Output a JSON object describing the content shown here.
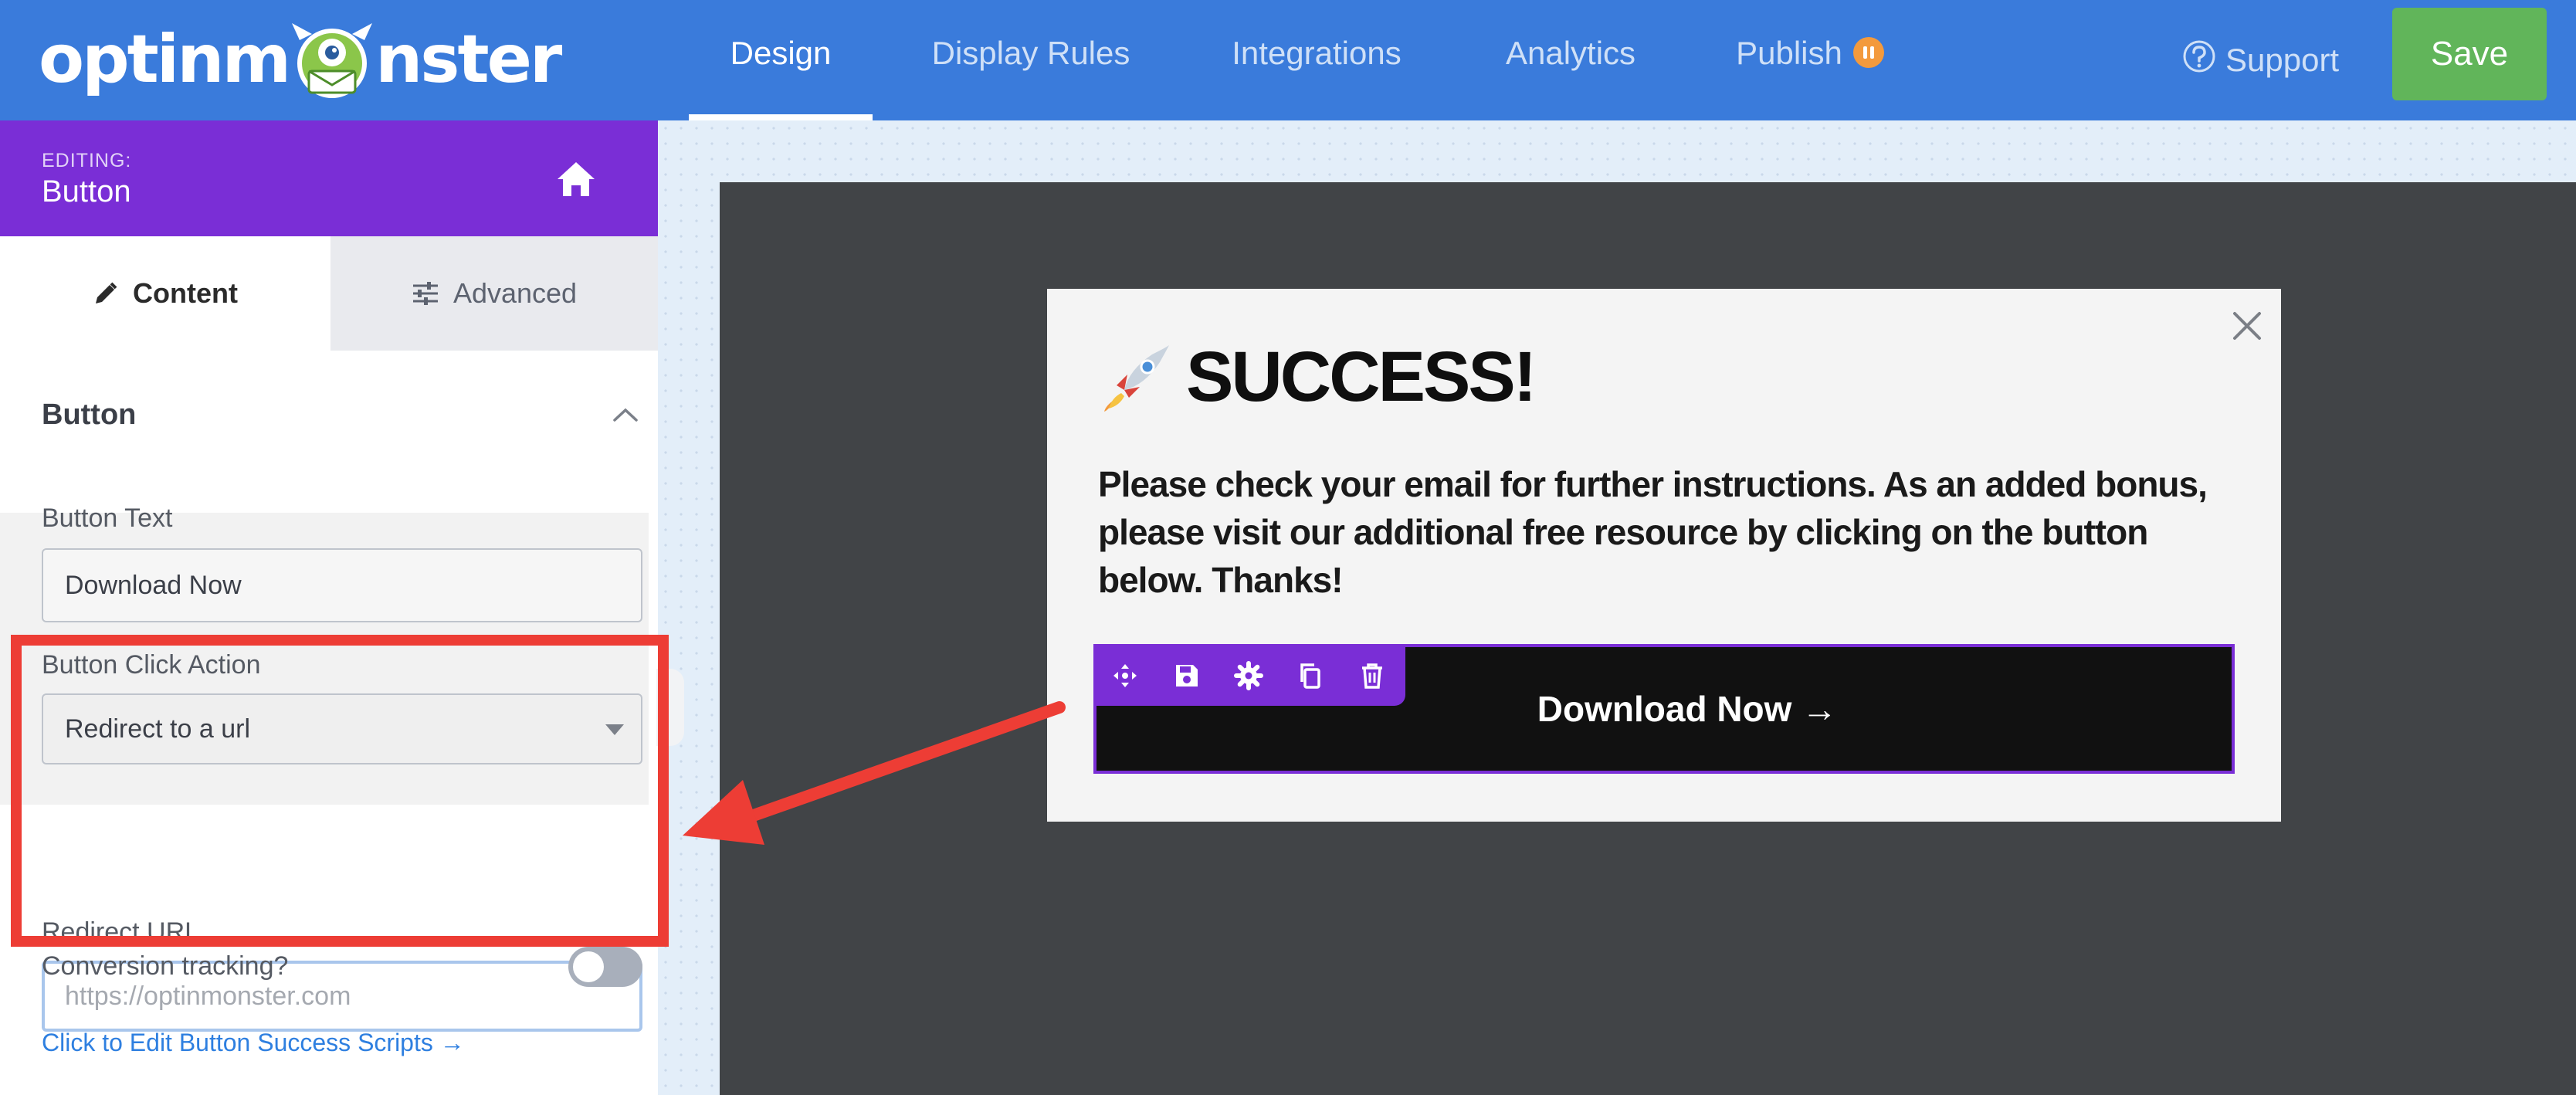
{
  "brand": {
    "logo_text_left": "optinm",
    "logo_text_right": "nster",
    "primary": "#3a7bdb",
    "accent": "#7a2ed6",
    "save_green": "#61b55a",
    "highlight_red": "#ed3d35"
  },
  "nav": {
    "tabs": [
      {
        "label": "Design",
        "active": true
      },
      {
        "label": "Display Rules",
        "active": false
      },
      {
        "label": "Integrations",
        "active": false
      },
      {
        "label": "Analytics",
        "active": false
      },
      {
        "label": "Publish",
        "active": false,
        "badge_icon": "pause-icon"
      }
    ],
    "support_label": "Support",
    "save_label": "Save"
  },
  "sidebar": {
    "editing_label": "EDITING:",
    "editing_title": "Button",
    "tabs": [
      {
        "label": "Content",
        "icon": "pencil-icon",
        "active": true
      },
      {
        "label": "Advanced",
        "icon": "sliders-icon",
        "active": false
      }
    ],
    "section_title": "Button",
    "fields": {
      "button_text_label": "Button Text",
      "button_text_value": "Download Now",
      "click_action_label": "Button Click Action",
      "click_action_value": "Redirect to a url",
      "redirect_url_label": "Redirect URL",
      "redirect_url_placeholder": "https://optinmonster.com",
      "conversion_label": "Conversion tracking?",
      "conversion_enabled": false
    },
    "scripts_link": "Click to Edit Button Success Scripts →"
  },
  "preview": {
    "title": "SUCCESS!",
    "title_icon": "rocket-icon",
    "body": "Please check your email for further instructions. As an added bonus, please visit our additional free resource by clicking on the button below. Thanks!",
    "cta_label": "Download Now →",
    "toolbar_icons": [
      "move-icon",
      "save-icon",
      "gear-icon",
      "copy-icon",
      "trash-icon"
    ]
  }
}
